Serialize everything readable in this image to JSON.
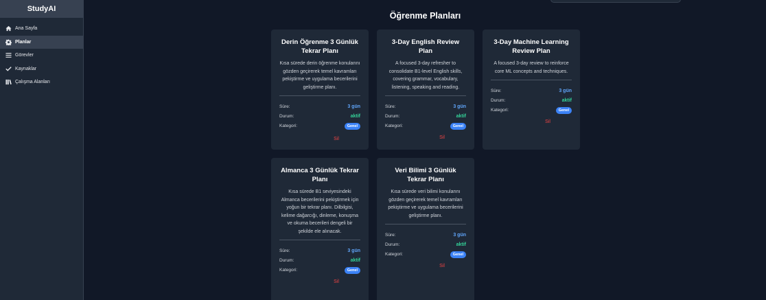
{
  "app": {
    "brand": "StudyAI"
  },
  "sidebar": {
    "items": [
      {
        "label": "Ana Sayfa",
        "icon": "home-icon"
      },
      {
        "label": "Planlar",
        "icon": "gear-icon",
        "active": true
      },
      {
        "label": "Görevler",
        "icon": "list-icon"
      },
      {
        "label": "Kaynaklar",
        "icon": "check-icon"
      },
      {
        "label": "Çalışma Alanları",
        "icon": "books-icon"
      }
    ]
  },
  "main": {
    "title": "Öğrenme Planları"
  },
  "cards": [
    {
      "title": "Derin Öğrenme 3 Günlük Tekrar Planı",
      "description": "Kısa sürede derin öğrenme konularını gözden geçirerek temel kavramları pekiştirme ve uygulama becerilerini geliştirme planı.",
      "duration_label": "Süre:",
      "duration": "3 gün",
      "status_label": "Durum:",
      "status": "aktif",
      "category_label": "Kategori:",
      "category": "Genel",
      "delete_label": "Sil"
    },
    {
      "title": "3-Day English Review Plan",
      "description": "A focused 3-day refresher to consolidate B1-level English skills, covering grammar, vocabulary, listening, speaking and reading.",
      "duration_label": "Süre:",
      "duration": "3 gün",
      "status_label": "Durum:",
      "status": "aktif",
      "category_label": "Kategori:",
      "category": "Genel",
      "delete_label": "Sil"
    },
    {
      "title": "3-Day Machine Learning Review Plan",
      "description": "A focused 3-day review to reinforce core ML concepts and techniques.",
      "duration_label": "Süre:",
      "duration": "3 gün",
      "status_label": "Durum:",
      "status": "aktif",
      "category_label": "Kategori:",
      "category": "Genel",
      "delete_label": "Sil"
    },
    {
      "title": "Almanca 3 Günlük Tekrar Planı",
      "description": "Kısa sürede B1 seviyesindeki Almanca becerilerini pekiştirmek için yoğun bir tekrar planı. Dilbilgisi, kelime dağarcığı, dinleme, konuşma ve okuma becerileri dengeli bir şekilde ele alınacak.",
      "duration_label": "Süre:",
      "duration": "3 gün",
      "status_label": "Durum:",
      "status": "aktif",
      "category_label": "Kategori:",
      "category": "Genel",
      "delete_label": "Sil"
    },
    {
      "title": "Veri Bilimi 3 Günlük Tekrar Planı",
      "description": "Kısa sürede veri bilimi konularını gözden geçirerek temel kavramları pekiştirme ve uygulama becerilerini geliştirme planı.",
      "duration_label": "Süre:",
      "duration": "3 gün",
      "status_label": "Durum:",
      "status": "aktif",
      "category_label": "Kategori:",
      "category": "Genel",
      "delete_label": "Sil"
    }
  ],
  "colors": {
    "background": "#111827",
    "sidebar": "#1f2937",
    "card": "#1f2937",
    "accent_blue": "#60a5fa",
    "status_green": "#34d399",
    "badge_blue": "#3b82f6",
    "delete_red": "#ef4444"
  }
}
